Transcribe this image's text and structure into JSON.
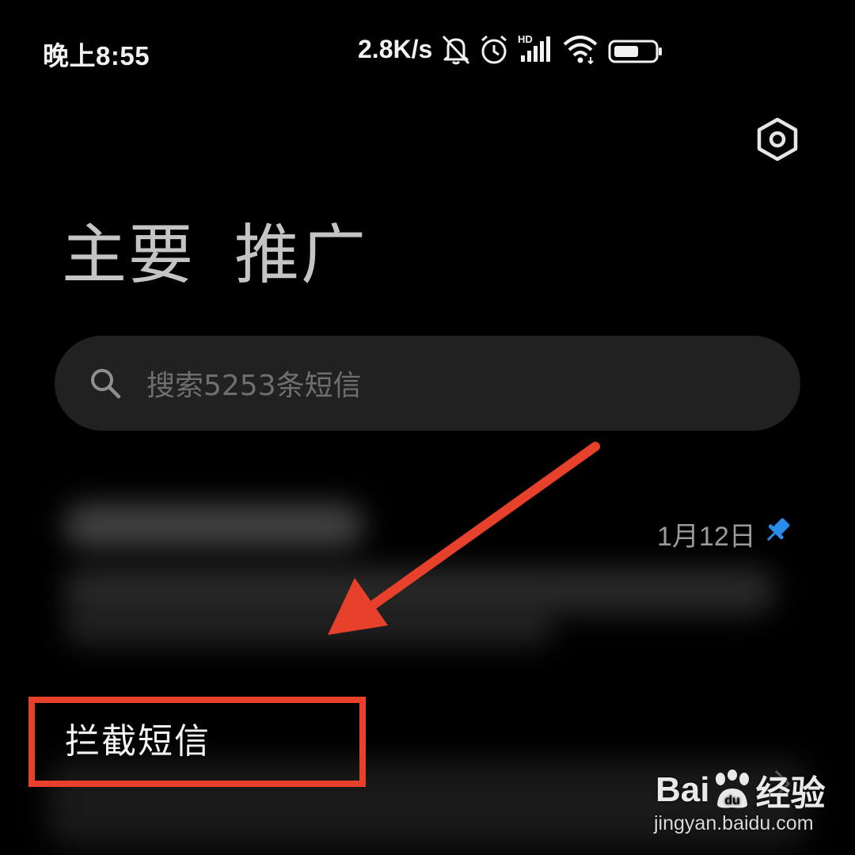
{
  "status_bar": {
    "time": "晚上8:55",
    "net_speed": "2.8K/s",
    "icons": [
      "bell-off-icon",
      "alarm-icon",
      "hd-signal-icon",
      "wifi-icon",
      "battery-icon"
    ],
    "hd_label": "HD"
  },
  "header": {
    "settings_icon": "hexagon-gear-icon"
  },
  "tabs": [
    {
      "label": "主要"
    },
    {
      "label": "推广"
    }
  ],
  "search": {
    "placeholder": "搜索5253条短信",
    "icon": "search-icon"
  },
  "conversation": {
    "date": "1月12日",
    "pinned": true,
    "pin_color": "#2b8be8"
  },
  "blocked_messages": {
    "label": "拦截短信"
  },
  "annotation": {
    "color": "#e8412b"
  },
  "watermark": {
    "brand_left": "Bai",
    "brand_mid": "du",
    "brand_right": "经验",
    "url": "jingyan.baidu.com"
  }
}
